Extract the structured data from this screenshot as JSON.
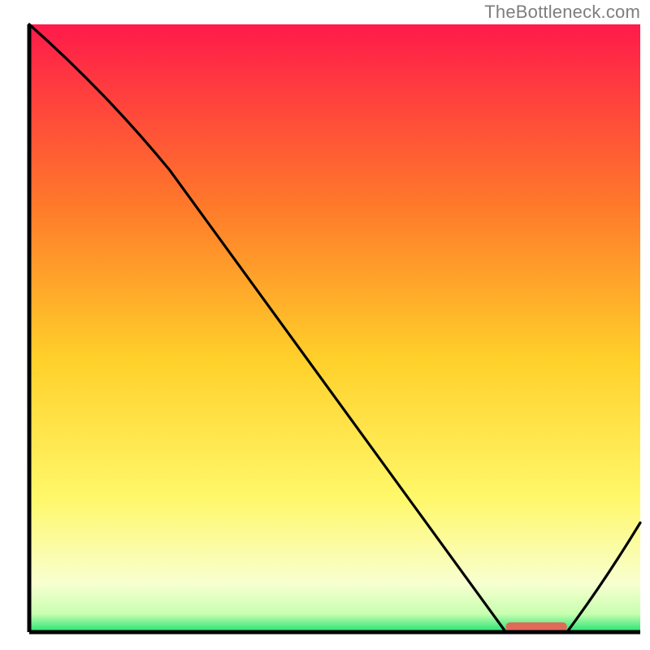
{
  "attribution": "TheBottleneck.com",
  "colors": {
    "gradient_top": "#ff1a4a",
    "gradient_upper_mid": "#ff7a2a",
    "gradient_mid": "#ffd02a",
    "gradient_lower_mid": "#fff86a",
    "gradient_near_bottom": "#f8ffd0",
    "gradient_bottom": "#1de36e",
    "curve_stroke": "#000000",
    "axis_stroke": "#000000",
    "marker_fill": "#e06a5a",
    "background": "#ffffff"
  },
  "chart_data": {
    "type": "line",
    "title": "",
    "xlabel": "",
    "ylabel": "",
    "xlim": [
      0,
      100
    ],
    "ylim": [
      0,
      100
    ],
    "grid": false,
    "legend": false,
    "x": [
      0,
      23,
      78,
      88,
      100
    ],
    "series": [
      {
        "name": "curve",
        "values": [
          100,
          76,
          0,
          0,
          18
        ]
      }
    ],
    "marker": {
      "x_start": 78,
      "x_end": 88,
      "y": 0
    },
    "notes": "Values are read off proportionally from axes; x is horizontal position (%), y is vertical position (% of full height). The curve descends from top-left, kinks around x≈23, reaches the baseline near x≈78–88 (marked band), then rises toward the right edge."
  }
}
